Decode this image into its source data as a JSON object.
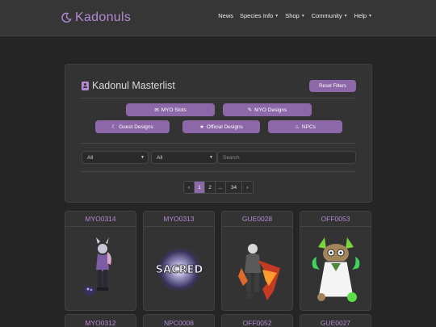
{
  "nav": {
    "brand": "Kadonuls",
    "links": [
      {
        "label": "News",
        "dropdown": false
      },
      {
        "label": "Species Info",
        "dropdown": true
      },
      {
        "label": "Shop",
        "dropdown": true
      },
      {
        "label": "Community",
        "dropdown": true
      },
      {
        "label": "Help",
        "dropdown": true
      }
    ]
  },
  "masterlist": {
    "title": "Kadonul Masterlist",
    "reset_label": "Reset Filters",
    "categories": [
      {
        "label": "MYO Slots",
        "icon": "envelope-icon"
      },
      {
        "label": "MYO Designs",
        "icon": "pencil-icon"
      },
      {
        "label": "Guest Designs",
        "icon": "moon-icon"
      },
      {
        "label": "Official Designs",
        "icon": "star-icon"
      },
      {
        "label": "NPCs",
        "icon": "fire-icon"
      }
    ],
    "filter1_value": "All",
    "filter2_value": "All",
    "search_placeholder": "Search",
    "pagination": {
      "prev": "‹",
      "pages": [
        "1",
        "2",
        "...",
        "34"
      ],
      "next": "›",
      "current": "1"
    }
  },
  "cards_row1": [
    "MYO0314",
    "MYO0313",
    "GUE0028",
    "OFF0053"
  ],
  "cards_row2": [
    "MYO0312",
    "NPC0008",
    "OFF0052",
    "GUE0027"
  ],
  "sacred_text": "SACRED",
  "colors": {
    "accent": "#8d68a8",
    "brand": "#b48ad4",
    "background": "#252525",
    "panel": "#333333"
  }
}
